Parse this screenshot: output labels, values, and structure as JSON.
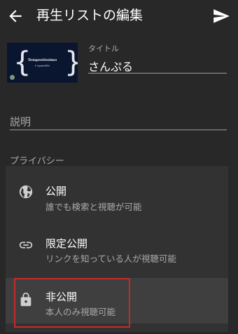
{
  "header": {
    "title": "再生リストの編集",
    "back_icon": "arrow-left-icon",
    "send_icon": "send-icon"
  },
  "thumbnail": {
    "title": "Tempestissimo",
    "subtitle": "t+pazolite"
  },
  "title_field": {
    "label": "タイトル",
    "value": "さんぷる"
  },
  "description_field": {
    "placeholder": "説明"
  },
  "privacy": {
    "label": "プライバシー",
    "options": [
      {
        "name": "公開",
        "description": "誰でも検索と視聴が可能",
        "icon": "globe-icon"
      },
      {
        "name": "限定公開",
        "description": "リンクを知っている人が視聴可能",
        "icon": "link-icon"
      },
      {
        "name": "非公開",
        "description": "本人のみ視聴可能",
        "icon": "lock-icon",
        "selected": true
      }
    ]
  },
  "colors": {
    "background": "#282828",
    "menu": "#323232",
    "selected": "#3f3f3f",
    "highlight_border": "#c62b2b"
  }
}
